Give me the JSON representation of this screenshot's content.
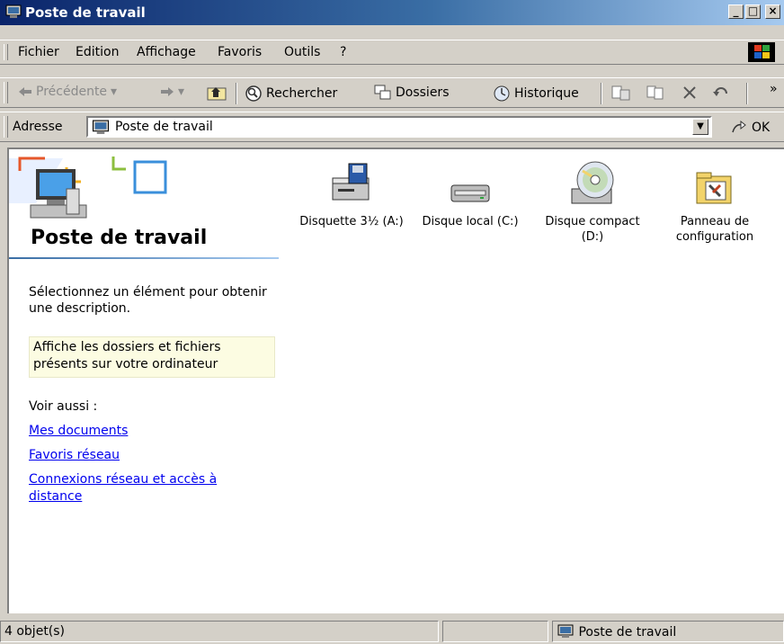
{
  "window": {
    "title": "Poste de travail",
    "buttons": [
      "_",
      "□",
      "×"
    ]
  },
  "menubar": {
    "items": [
      {
        "label": "Fichier"
      },
      {
        "label": "Edition"
      },
      {
        "label": "Affichage"
      },
      {
        "label": "Favoris"
      },
      {
        "label": "Outils"
      },
      {
        "label": "?"
      }
    ]
  },
  "toolbar": {
    "back_label": "Précédente",
    "search_label": "Rechercher",
    "folders_label": "Dossiers",
    "history_label": "Historique",
    "chevron": "»"
  },
  "address": {
    "label": "Adresse",
    "value": "Poste de travail",
    "go_label": "OK"
  },
  "sidebar": {
    "title": "Poste de travail",
    "description": "Sélectionnez un élément pour obtenir une description.",
    "info": "Affiche les dossiers et fichiers présents sur votre ordinateur",
    "see_also": "Voir aussi :",
    "links": [
      "Mes documents",
      "Favoris réseau",
      "Connexions réseau et accès à distance"
    ]
  },
  "drives": [
    {
      "label": "Disquette 3½ (A:)",
      "icon": "floppy-drive-icon"
    },
    {
      "label": "Disque local (C:)",
      "icon": "hard-disk-icon"
    },
    {
      "label": "Disque compact (D:)",
      "icon": "cd-drive-icon"
    },
    {
      "label": "Panneau de configuration",
      "icon": "control-panel-icon"
    }
  ],
  "statusbar": {
    "count": "4 objet(s)",
    "location": "Poste de travail"
  },
  "colors": {
    "titlebar_start": "#0a246a",
    "titlebar_end": "#a6caf0",
    "link": "#0000ee",
    "infobox": "#fcfce2"
  }
}
